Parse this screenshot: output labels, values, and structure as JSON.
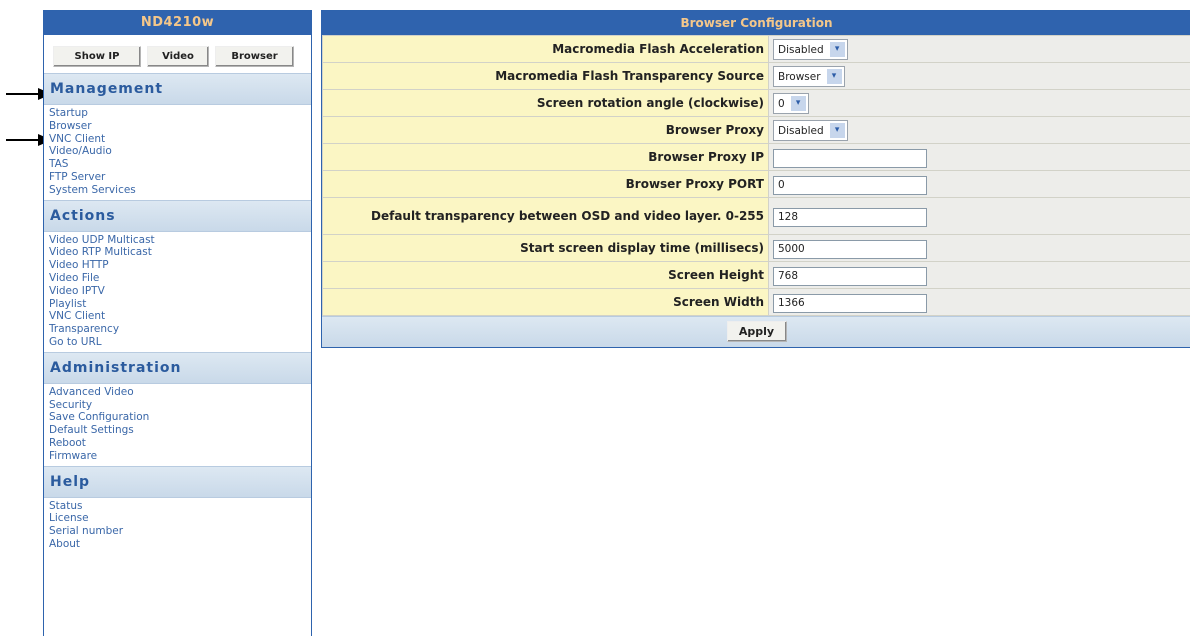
{
  "sidebar": {
    "device_name": "ND4210w",
    "buttons": [
      "Show IP",
      "Video",
      "Browser"
    ],
    "sections": [
      {
        "title": "Management",
        "links": [
          "Startup",
          "Browser",
          "VNC Client",
          "Video/Audio",
          "TAS",
          "FTP Server",
          "System Services"
        ]
      },
      {
        "title": "Actions",
        "links": [
          "Video UDP Multicast",
          "Video RTP Multicast",
          "Video HTTP",
          "Video File",
          "Video IPTV",
          "Playlist",
          "VNC Client",
          "Transparency",
          "Go to URL"
        ]
      },
      {
        "title": "Administration",
        "links": [
          "Advanced Video",
          "Security",
          "Save Configuration",
          "Default Settings",
          "Reboot",
          "Firmware"
        ]
      },
      {
        "title": "Help",
        "links": [
          "Status",
          "License",
          "Serial number",
          "About"
        ]
      }
    ]
  },
  "main": {
    "title": "Browser Configuration",
    "rows": [
      {
        "label": "Macromedia Flash Acceleration",
        "type": "select",
        "value": "Disabled"
      },
      {
        "label": "Macromedia Flash Transparency Source",
        "type": "select",
        "value": "Browser"
      },
      {
        "label": "Screen rotation angle (clockwise)",
        "type": "select",
        "value": "0"
      },
      {
        "label": "Browser Proxy",
        "type": "select",
        "value": "Disabled"
      },
      {
        "label": "Browser Proxy IP",
        "type": "input",
        "value": ""
      },
      {
        "label": "Browser Proxy PORT",
        "type": "input",
        "value": "0"
      },
      {
        "label": "Default transparency between OSD and video layer. 0-255",
        "type": "input",
        "value": "128"
      },
      {
        "label": "Start screen display time (millisecs)",
        "type": "input",
        "value": "5000"
      },
      {
        "label": "Screen Height",
        "type": "input",
        "value": "768"
      },
      {
        "label": "Screen Width",
        "type": "input",
        "value": "1366"
      }
    ],
    "apply_label": "Apply"
  },
  "icons": {
    "dropdown": "chevron-down-icon",
    "annotation": "arrow-right-icon"
  }
}
